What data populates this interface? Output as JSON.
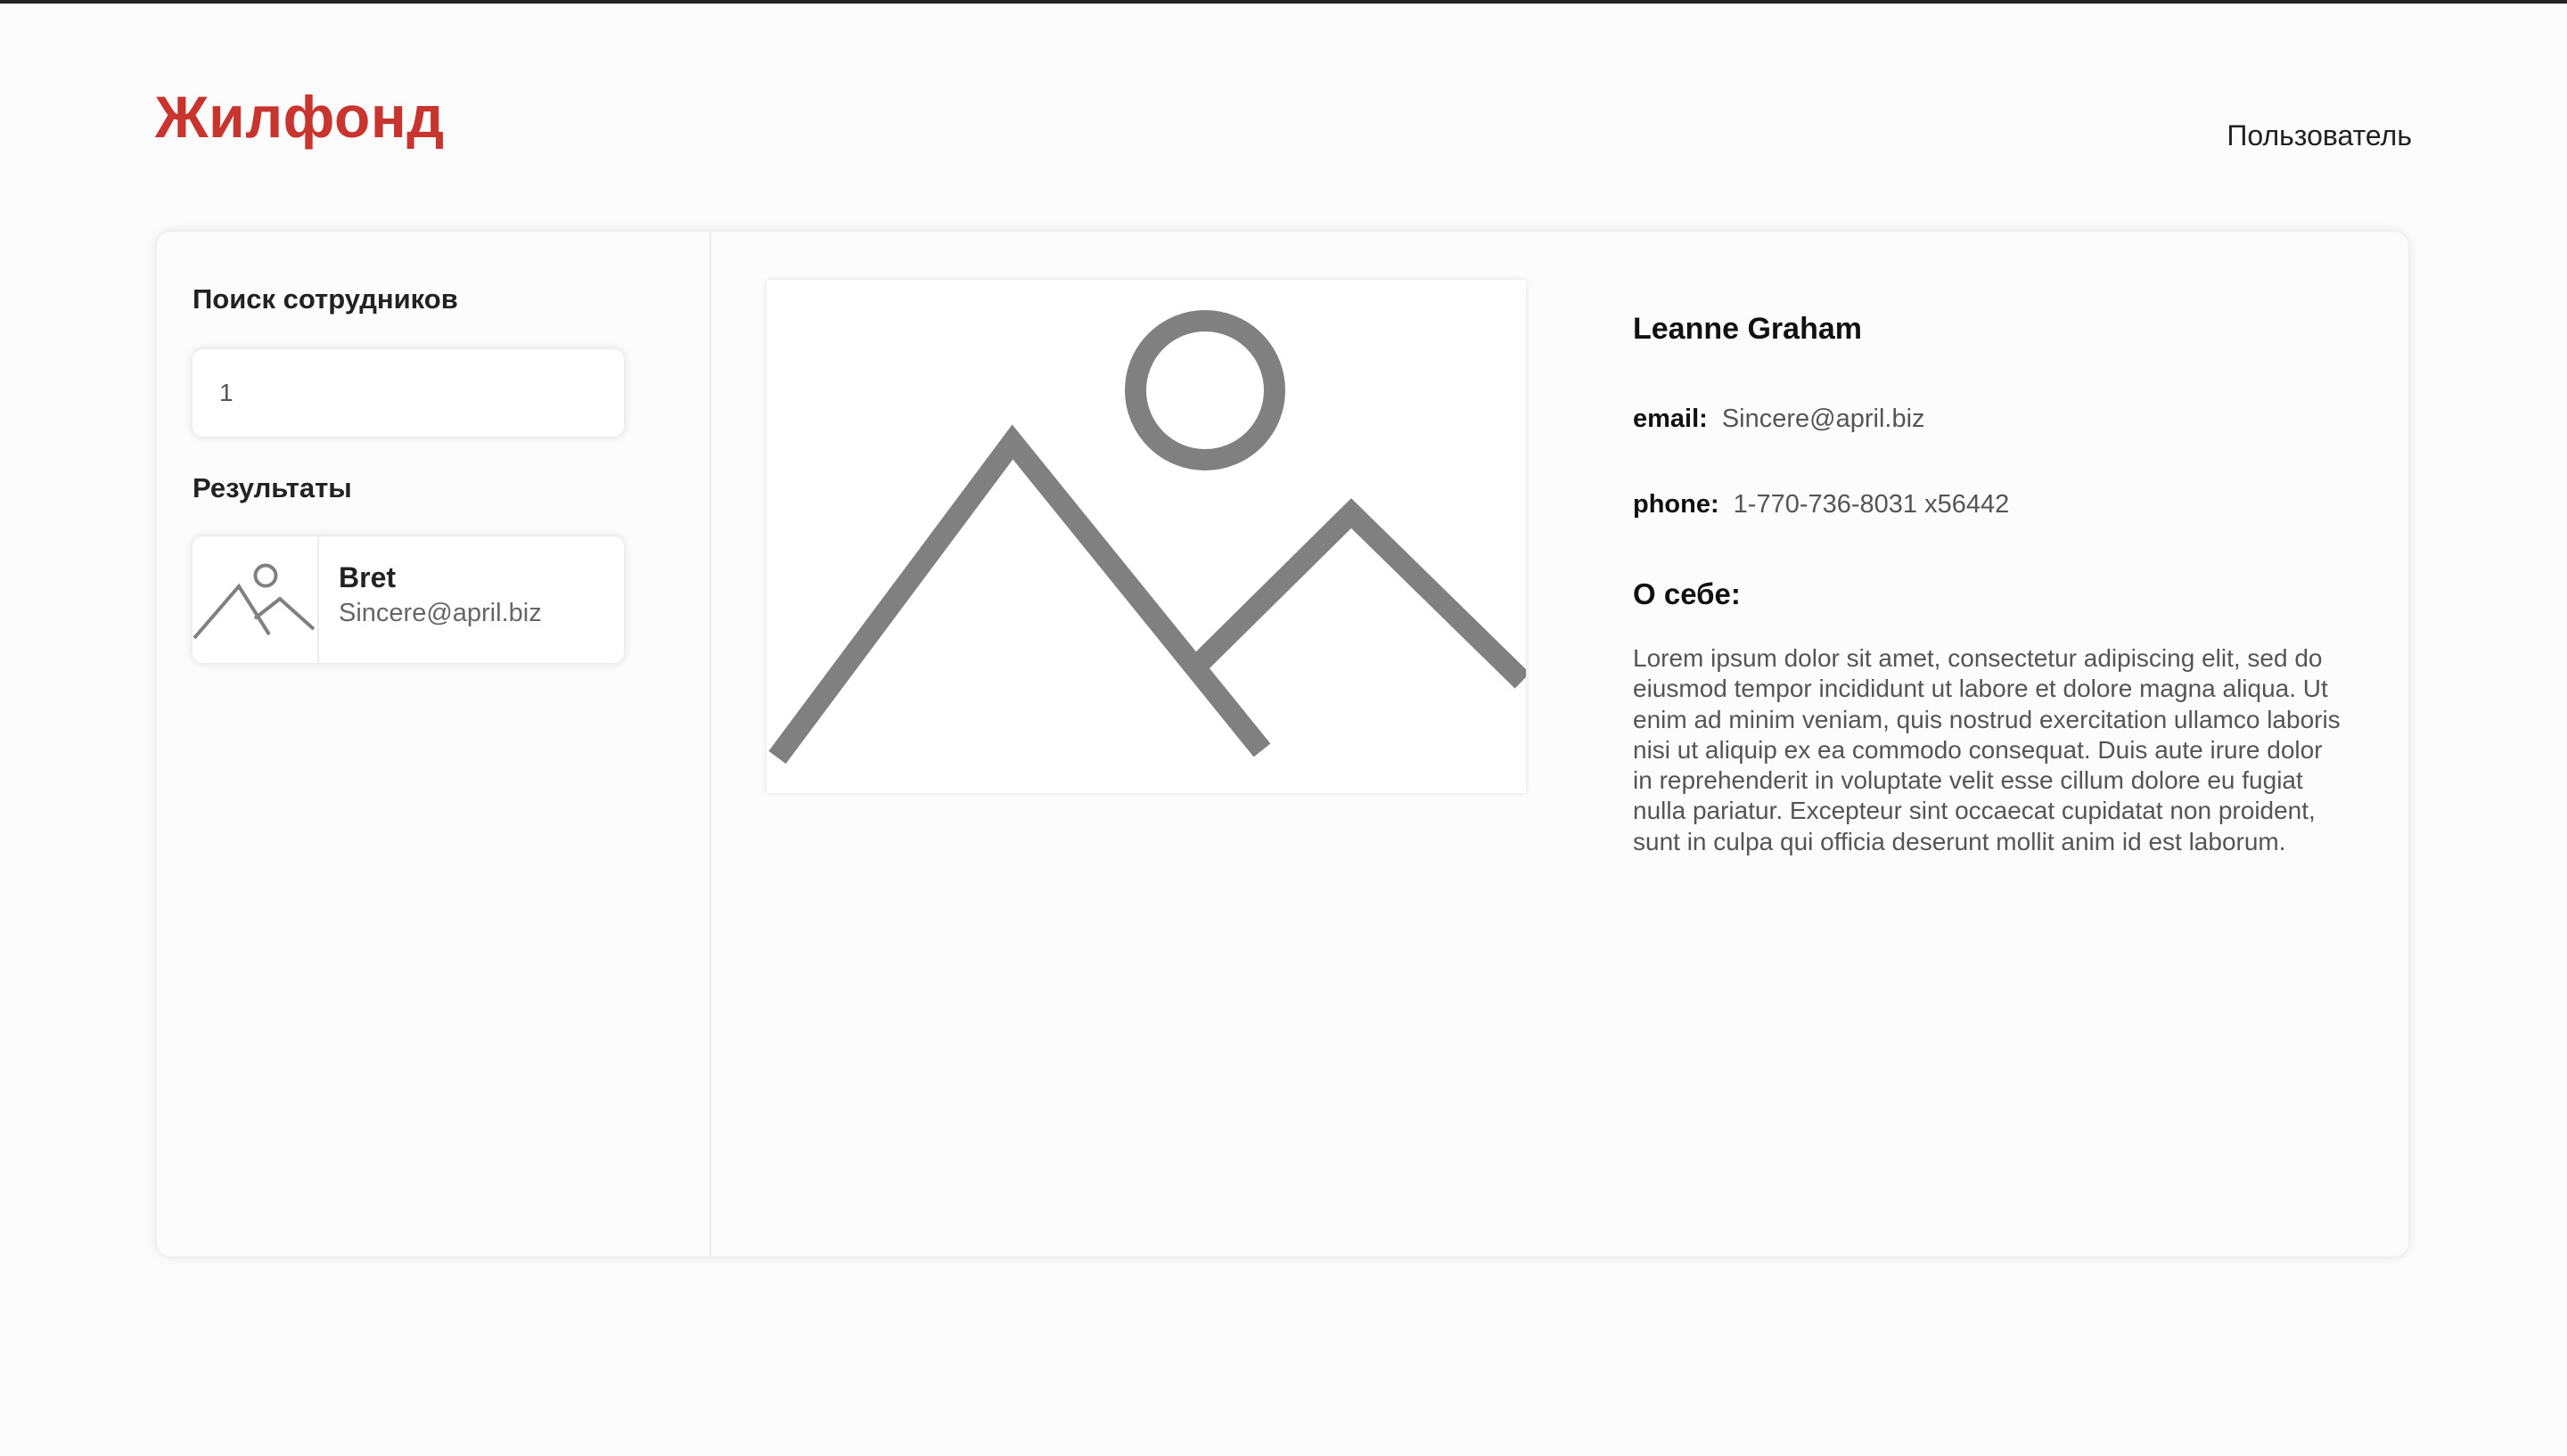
{
  "header": {
    "logo": "Жилфонд",
    "user_link": "Пользователь"
  },
  "sidebar": {
    "search_title": "Поиск сотрудников",
    "search_value": "1",
    "results_title": "Результаты",
    "results": [
      {
        "name": "Bret",
        "email": "Sincere@april.biz",
        "icon": "image-placeholder-icon"
      }
    ]
  },
  "profile": {
    "photo_icon": "image-placeholder-icon",
    "name": "Leanne Graham",
    "email_label": "email:",
    "email": "Sincere@april.biz",
    "phone_label": "phone:",
    "phone": "1-770-736-8031 x56442",
    "about_title": "О себе:",
    "about_text": "Lorem ipsum dolor sit amet, consectetur adipiscing elit, sed do eiusmod tempor incididunt ut labore et dolore magna aliqua. Ut enim ad minim veniam, quis nostrud exercitation ullamco laboris nisi ut aliquip ex ea commodo consequat. Duis aute irure dolor in reprehenderit in voluptate velit esse cillum dolore eu fugiat nulla pariatur. Excepteur sint occaecat cupidatat non proident, sunt in culpa qui officia deserunt mollit anim id est laborum."
  },
  "colors": {
    "brand": "#c8352e",
    "placeholder_gray": "#808080",
    "background": "#fcfcfc"
  }
}
